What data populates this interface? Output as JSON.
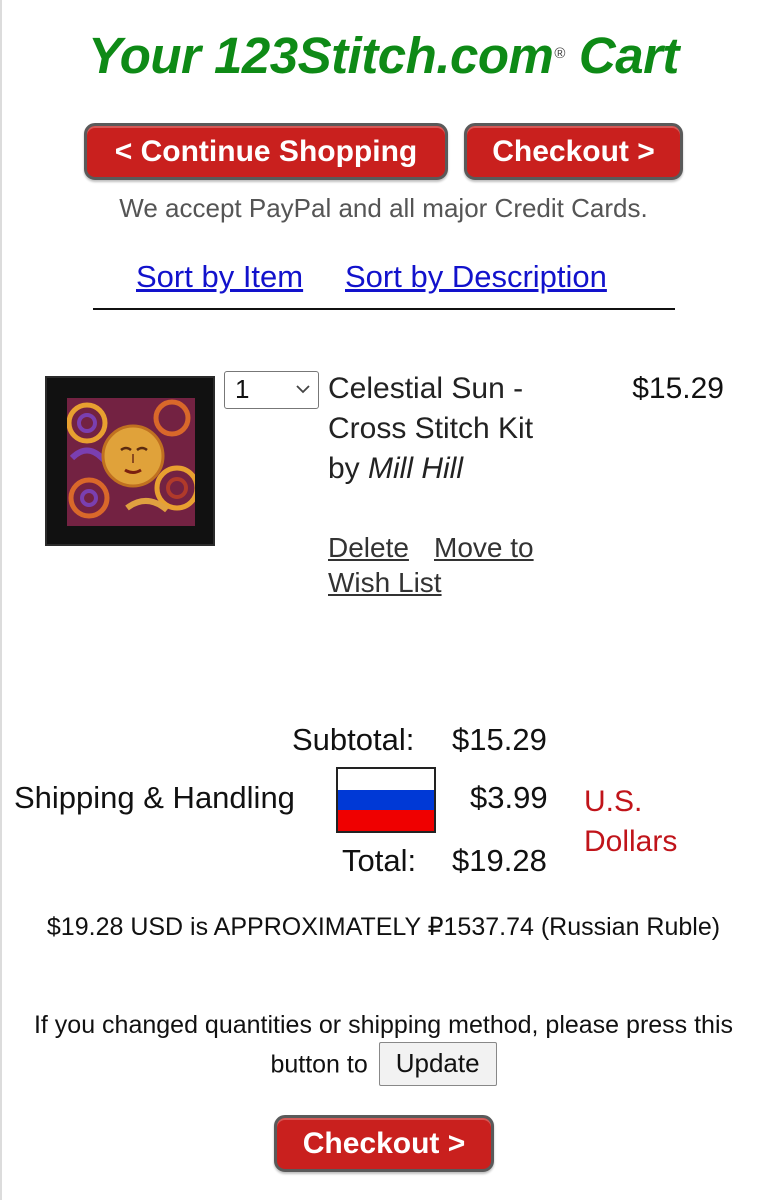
{
  "header": {
    "title_prefix": "Your 123Stitch.com",
    "registered_mark": "®",
    "title_suffix": "Cart"
  },
  "buttons": {
    "continue_shopping": "< Continue Shopping",
    "checkout_top": "Checkout >",
    "checkout_bottom": "Checkout >",
    "update": "Update"
  },
  "payment_note": "We accept PayPal and all major Credit Cards.",
  "sort": {
    "by_item": "Sort by Item",
    "by_description": "Sort by Description"
  },
  "cart_items": [
    {
      "quantity": "1",
      "title": "Celestial Sun - Cross Stitch Kit",
      "by": "by",
      "brand": "Mill Hill",
      "price": "$15.29",
      "delete_label": "Delete",
      "wishlist_label_1": "Move to",
      "wishlist_label_2": "Wish List"
    }
  ],
  "totals": {
    "subtotal_label": "Subtotal:",
    "subtotal_value": "$15.29",
    "shipping_label": "Shipping & Handling",
    "shipping_value": "$3.99",
    "total_label": "Total:",
    "total_value": "$19.28",
    "currency_label": "U.S. Dollars"
  },
  "flag_colors": [
    "#ffffff",
    "#0039d6",
    "#ef0000"
  ],
  "conversion_note": "$19.28 USD is APPROXIMATELY ₽1537.74 (Russian Ruble)",
  "update_note": {
    "line": "If you changed quantities or shipping method, please press this button to"
  },
  "colors": {
    "brand_green": "#0e8a16",
    "button_red": "#c9201e",
    "link_blue": "#1212cc",
    "currency_red": "#c0141a"
  }
}
